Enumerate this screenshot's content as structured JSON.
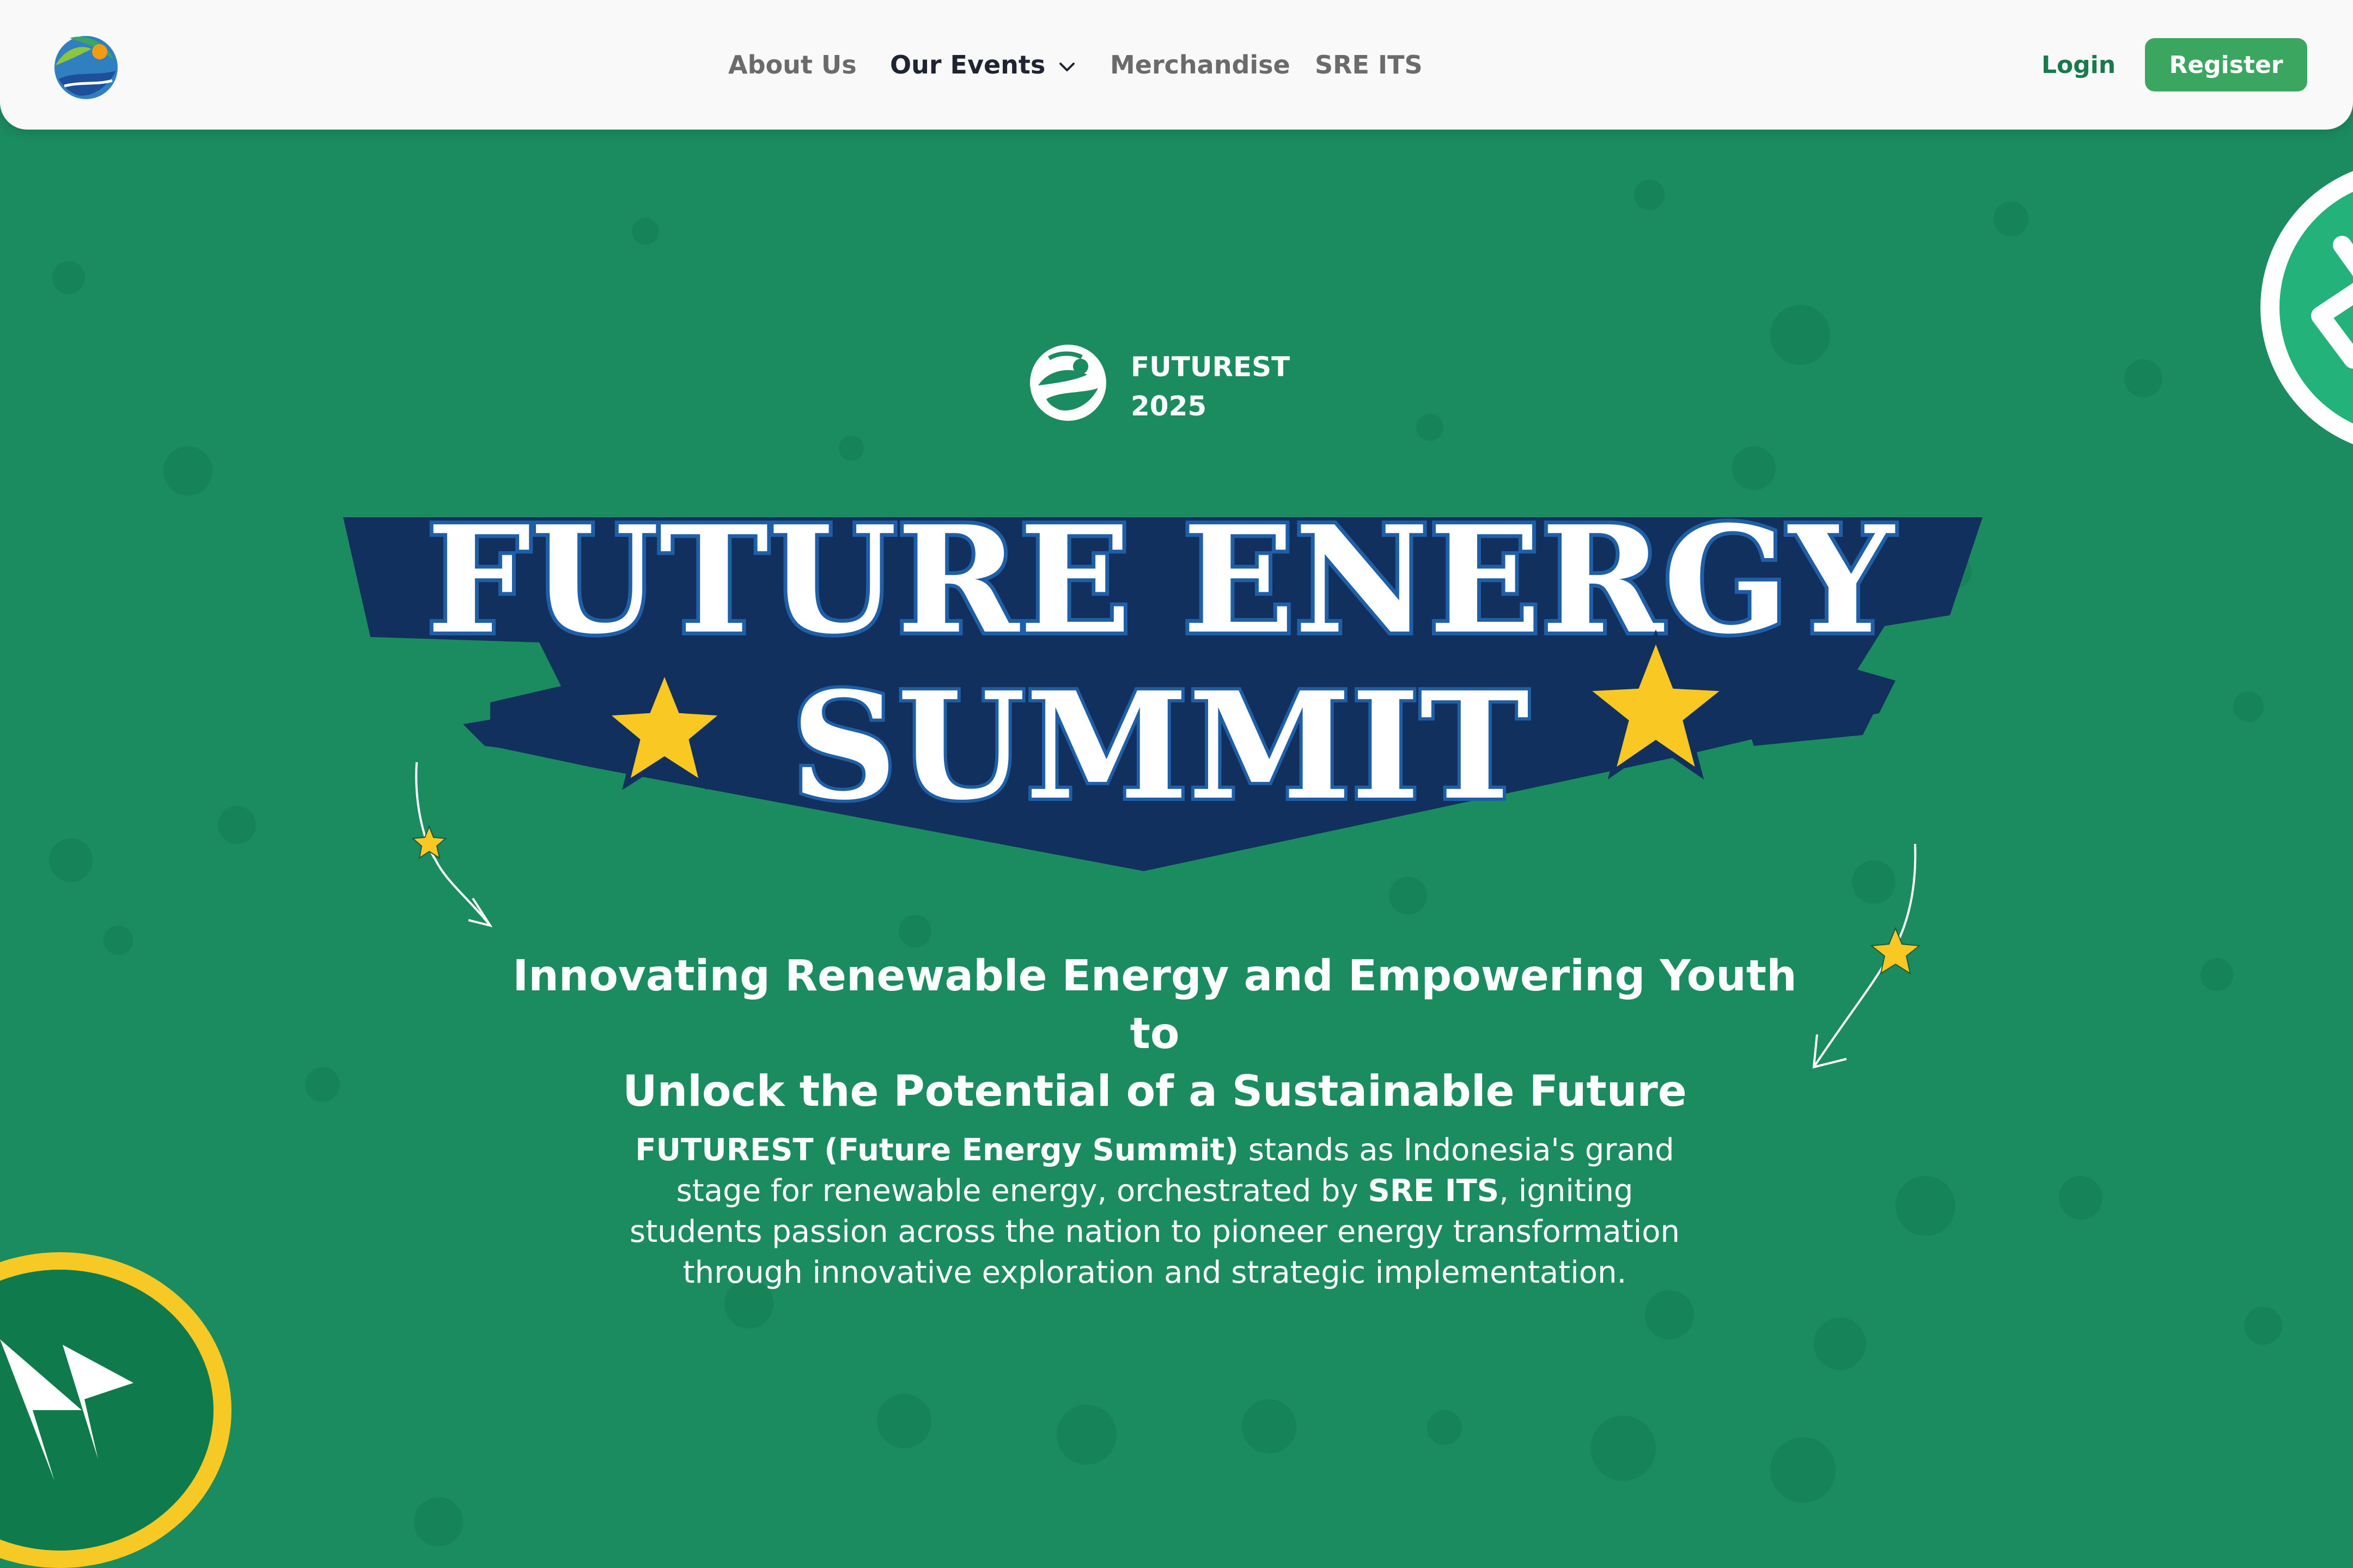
{
  "navbar": {
    "links": [
      {
        "label": "About Us"
      },
      {
        "label": "Our Events"
      },
      {
        "label": "Merchandise"
      },
      {
        "label": "SRE ITS"
      }
    ],
    "login_label": "Login",
    "register_label": "Register"
  },
  "hero": {
    "brand_line1": "FUTUREST",
    "brand_line2": "2025",
    "title_line1": "FUTURE ENERGY",
    "title_line2": "SUMMIT",
    "headline_line1": "Innovating Renewable Energy and Empowering Youth to",
    "headline_line2": "Unlock the Potential of a Sustainable Future",
    "description": {
      "strong1": "FUTUREST (Future Energy Summit)",
      "text1": " stands as Indonesia's grand stage for renewable energy, orchestrated by ",
      "strong2": "SRE ITS",
      "text2": ", igniting students passion across the nation to pioneer energy transformation through innovative exploration and strategic implementation."
    }
  },
  "colors": {
    "hero_bg": "#1b8b60",
    "nav_bg": "#f9f9f9",
    "register_bg": "#3aa660",
    "login_text": "#1a7a4c",
    "title_navy": "#12305e",
    "star_yellow": "#f9c823"
  },
  "icons": {
    "logo": "futurest-logo-icon",
    "chevron": "chevron-down-icon",
    "star": "star-icon",
    "arrow": "curved-arrow-icon"
  }
}
